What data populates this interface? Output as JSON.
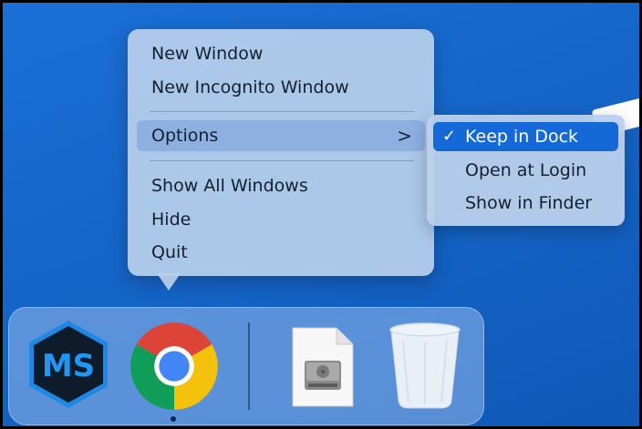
{
  "context_menu": {
    "items": [
      {
        "label": "New Window"
      },
      {
        "label": "New Incognito Window"
      },
      {
        "label": "Options",
        "has_submenu": true,
        "highlighted": true
      },
      {
        "label": "Show All Windows"
      },
      {
        "label": "Hide"
      },
      {
        "label": "Quit"
      }
    ],
    "submenu_indicator": ">"
  },
  "submenu": {
    "items": [
      {
        "label": "Keep in Dock",
        "checked": true,
        "check_glyph": "✓"
      },
      {
        "label": "Open at Login",
        "checked": false
      },
      {
        "label": "Show in Finder",
        "checked": false
      }
    ]
  },
  "dock": {
    "apps": [
      {
        "icon": "ms-app-icon",
        "letters": "MS",
        "running": false
      },
      {
        "icon": "chrome-icon",
        "running": true
      },
      {
        "icon": "disk-image-file-icon",
        "running": false
      },
      {
        "icon": "trash-icon",
        "running": false
      }
    ]
  },
  "colors": {
    "desktop": "#1565c8",
    "menu_bg": "#bad0ec",
    "selected": "#1468d8"
  }
}
